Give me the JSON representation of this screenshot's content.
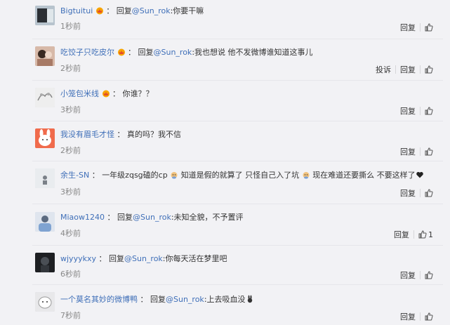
{
  "comments": [
    {
      "name": "Bigtuitui",
      "colon": "：",
      "reply_prefix": "回复",
      "mention": "@Sun_rok",
      "text": ":你要干嘛",
      "time": "1秒前",
      "actions": {
        "reply": "回复"
      }
    },
    {
      "name": "吃饺子只吃皮尔",
      "colon": "：",
      "reply_prefix": "回复",
      "mention": "@Sun_rok",
      "text": ":我也想说 他不发微博谁知道这事儿",
      "time": "2秒前",
      "actions": {
        "report": "投诉",
        "reply": "回复"
      }
    },
    {
      "name": "小笼包米线",
      "colon": "：",
      "text": "你谁？？",
      "time": "3秒前",
      "actions": {
        "reply": "回复"
      }
    },
    {
      "name": "我没有眉毛才怪",
      "colon": "：",
      "text": "真的吗？我不信",
      "time": "2秒前",
      "actions": {
        "reply": "回复"
      }
    },
    {
      "name": "余生-SN",
      "colon": "：",
      "text_parts": [
        "一年级zqsg磕的cp",
        "知道是假的就算了 只怪自己入了坑",
        "现在难道还要撕么 不要这样了"
      ],
      "time": "3秒前",
      "actions": {
        "reply": "回复"
      }
    },
    {
      "name": "Miaow1240",
      "colon": "：",
      "reply_prefix": "回复",
      "mention": "@Sun_rok",
      "text": ":未知全貌，不予置评",
      "time": "4秒前",
      "actions": {
        "reply": "回复",
        "like_count": "1"
      }
    },
    {
      "name": "wjyyykxy",
      "colon": "：",
      "reply_prefix": "回复",
      "mention": "@Sun_rok",
      "text": ":你每天活在梦里吧",
      "time": "6秒前",
      "actions": {
        "reply": "回复"
      }
    },
    {
      "name": "一个莫名其妙的微博鸭",
      "colon": "：",
      "reply_prefix": "回复",
      "mention": "@Sun_rok",
      "text": ":上去吸血没",
      "time": "7秒前",
      "actions": {
        "reply": "回复"
      }
    }
  ],
  "colors": {
    "background": "#f2f2f5",
    "link": "#3f6fb8",
    "muted": "#888888",
    "divider": "#e6e6ea"
  },
  "icons": {
    "vip_badge": "vip-crown-icon",
    "like": "thumbs-up-icon",
    "emoji_dog": "dog-face-emoji",
    "emoji_heart": "heart-icon",
    "emoji_bunny": "bunny-emoji"
  }
}
